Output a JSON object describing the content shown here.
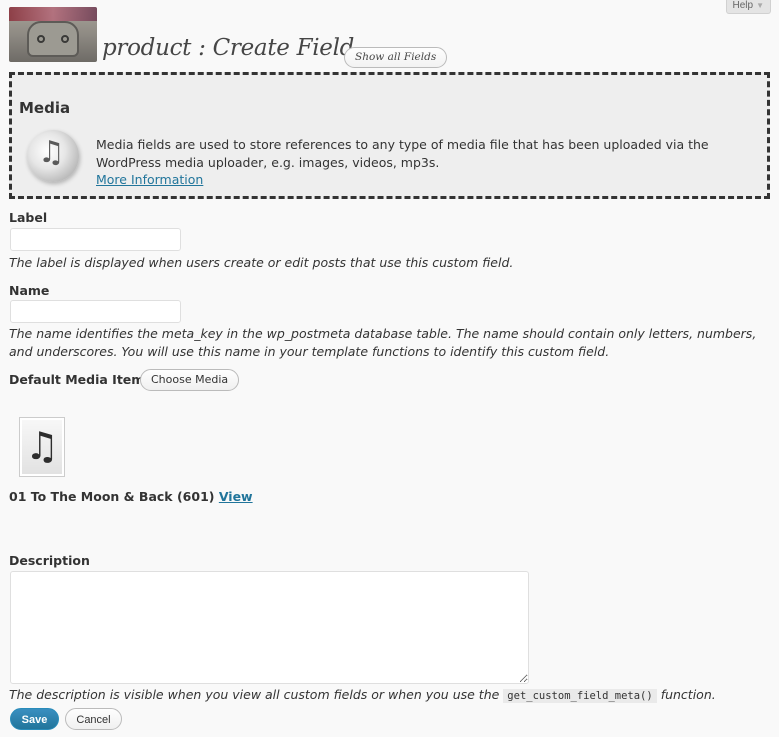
{
  "help_tab": {
    "label": "Help"
  },
  "header": {
    "title": "product : Create Field",
    "show_all_label": "Show all Fields"
  },
  "media_box": {
    "heading": "Media",
    "description": "Media fields are used to store references to any type of media file that has been uploaded via the WordPress media uploader, e.g. images, videos, mp3s.",
    "more_link": "More Information"
  },
  "form": {
    "label": {
      "label": "Label",
      "value": "",
      "help": "The label is displayed when users create or edit posts that use this custom field."
    },
    "name": {
      "label": "Name",
      "value": "",
      "help": "The name identifies the meta_key in the wp_postmeta database table. The name should contain only letters, numbers, and underscores. You will use this name in your template functions to identify this custom field."
    },
    "default_media": {
      "label": "Default Media Item",
      "choose_label": "Choose Media",
      "item_name": "01 To The Moon & Back (601)",
      "view_link": "View"
    },
    "description": {
      "label": "Description",
      "value": "",
      "help_before": "The description is visible when you view all custom fields or when you use the",
      "help_code": "get_custom_field_meta()",
      "help_after": "function."
    }
  },
  "actions": {
    "save_label": "Save",
    "cancel_label": "Cancel"
  },
  "colors": {
    "link": "#21759b",
    "primary_button": "#21759b",
    "box_border": "#333333",
    "box_background": "#eeeeee"
  },
  "icons": {
    "media_type": "music-note-icon",
    "thumbnail": "music-note-icon"
  }
}
